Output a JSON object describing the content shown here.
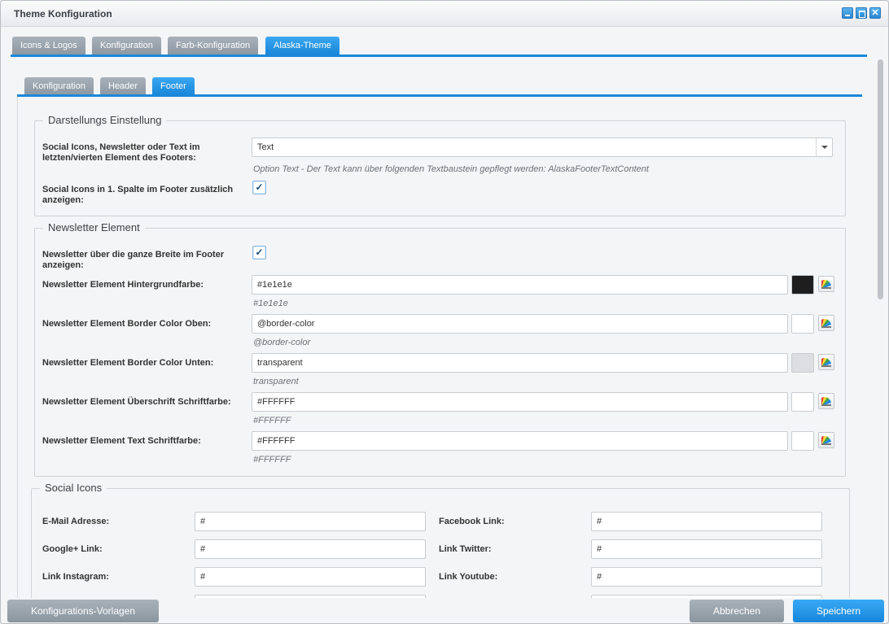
{
  "window": {
    "title": "Theme Konfiguration"
  },
  "main_tabs": [
    {
      "label": "Icons & Logos"
    },
    {
      "label": "Konfiguration"
    },
    {
      "label": "Farb-Konfiguration"
    },
    {
      "label": "Alaska-Theme",
      "active": true
    }
  ],
  "sub_tabs": [
    {
      "label": "Konfiguration"
    },
    {
      "label": "Header"
    },
    {
      "label": "Footer",
      "active": true
    }
  ],
  "darstellung": {
    "legend": "Darstellungs Einstellung",
    "element_label": "Social Icons, Newsletter oder Text im letzten/vierten Element des Footers:",
    "element_value": "Text",
    "element_hint": "Option Text - Der Text kann über folgenden Textbaustein gepflegt werden: AlaskaFooterTextContent",
    "social_col_label": "Social Icons in 1. Spalte im Footer zusätzlich anzeigen:",
    "social_col_checked": true
  },
  "newsletter": {
    "legend": "Newsletter Element",
    "full_width_label": "Newsletter über die ganze Breite im Footer anzeigen:",
    "full_width_checked": true,
    "colors": [
      {
        "label": "Newsletter Element Hintergrundfarbe:",
        "value": "#1e1e1e",
        "hint": "#1e1e1e",
        "swatch": "#1e1e1e"
      },
      {
        "label": "Newsletter Element Border Color Oben:",
        "value": "@border-color",
        "hint": "@border-color",
        "swatch": "#ffffff"
      },
      {
        "label": "Newsletter Element Border Color Unten:",
        "value": "transparent",
        "hint": "transparent",
        "swatch": "#dcdee1"
      },
      {
        "label": "Newsletter Element Überschrift Schriftfarbe:",
        "value": "#FFFFFF",
        "hint": "#FFFFFF",
        "swatch": "#ffffff"
      },
      {
        "label": "Newsletter Element Text Schriftfarbe:",
        "value": "#FFFFFF",
        "hint": "#FFFFFF",
        "swatch": "#ffffff"
      }
    ]
  },
  "social": {
    "legend": "Social Icons",
    "fields": [
      {
        "label": "E-Mail Adresse:",
        "value": "#"
      },
      {
        "label": "Facebook Link:",
        "value": "#"
      },
      {
        "label": "Google+ Link:",
        "value": "#"
      },
      {
        "label": "Link Twitter:",
        "value": "#"
      },
      {
        "label": "Link Instagram:",
        "value": "#"
      },
      {
        "label": "Link Youtube:",
        "value": "#"
      }
    ]
  },
  "footer": {
    "templates_button": "Konfigurations-Vorlagen",
    "cancel_button": "Abbrechen",
    "save_button": "Speichern"
  },
  "colors": {
    "accent": "#1a88da",
    "tab_inactive": "#97a1ab"
  }
}
